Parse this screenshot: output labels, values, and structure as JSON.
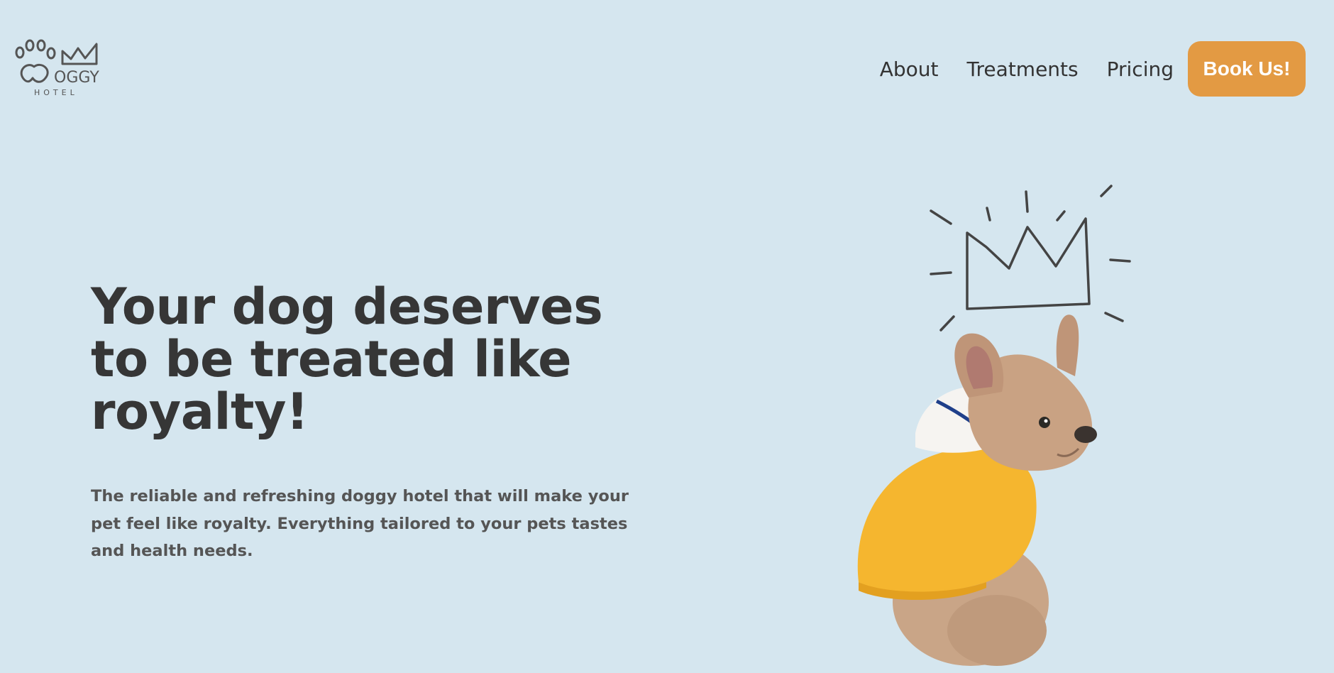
{
  "logo": {
    "icon": "paw-crown-logo",
    "word": "OGGY",
    "sub": "HOTEL"
  },
  "nav": {
    "items": [
      {
        "label": "About"
      },
      {
        "label": "Treatments"
      },
      {
        "label": "Pricing"
      }
    ],
    "cta": "Book Us!"
  },
  "hero": {
    "title": "Your dog deserves to be treated like royalty!",
    "description": "The reliable and refreshing doggy hotel that will make your pet feel like royalty. Everything tailored to your pets tastes and health needs.",
    "image": {
      "icon": "crowned-dog-illustration"
    }
  },
  "colors": {
    "background": "#d5e6ef",
    "accent": "#e39a43",
    "text": "#363636"
  }
}
